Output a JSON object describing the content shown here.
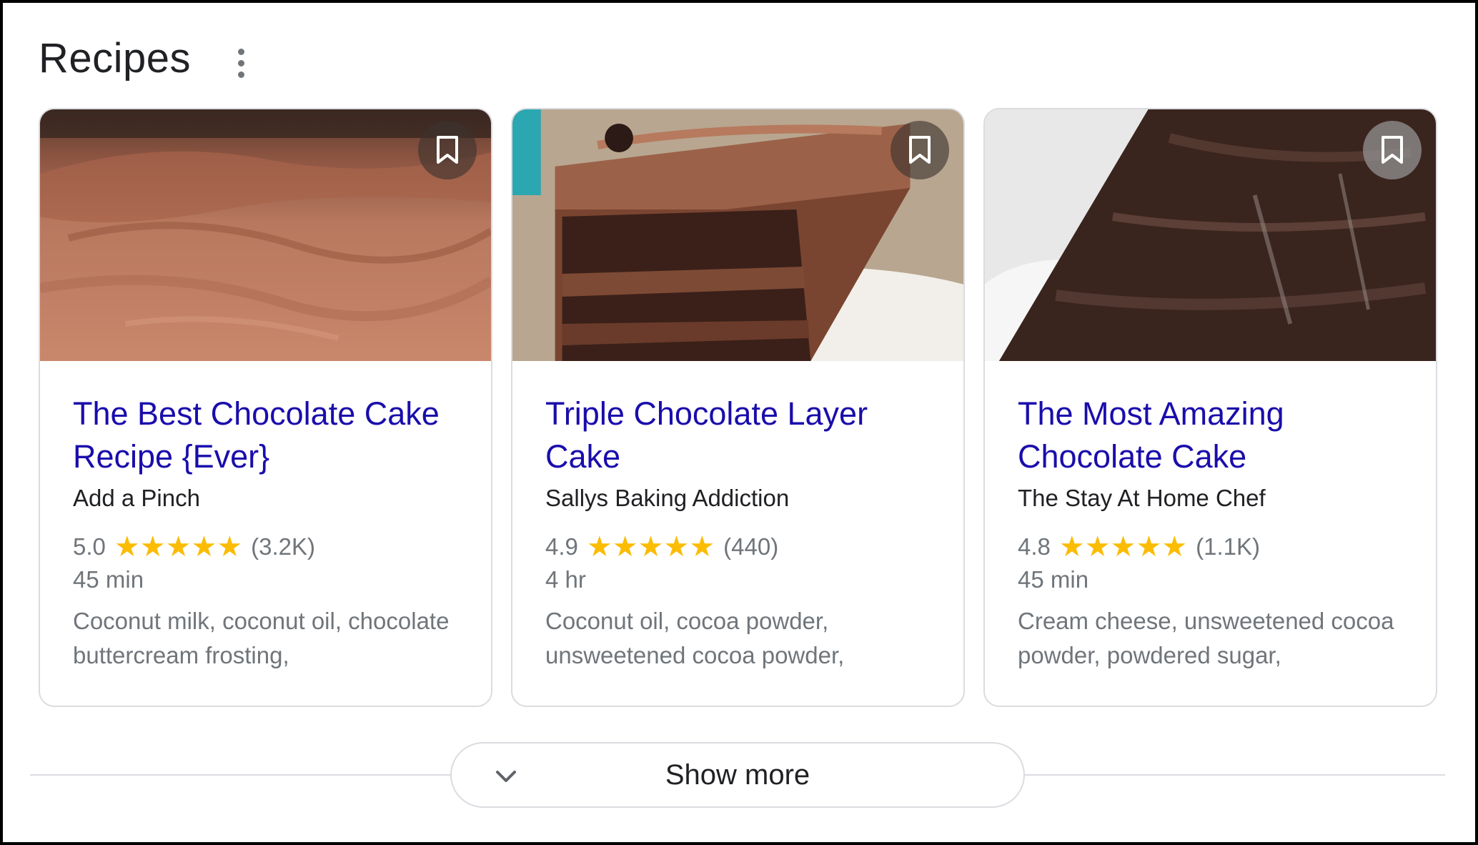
{
  "header": {
    "title": "Recipes",
    "menu_icon": "more-vert-icon"
  },
  "colors": {
    "title_link": "#1a0dab",
    "star": "#fbbc04",
    "muted": "#70757a",
    "text": "#202124",
    "border": "#dadce0"
  },
  "cards": [
    {
      "title": "The Best Chocolate Cake Recipe {Ever}",
      "source": "Add a Pinch",
      "rating": "5.0",
      "stars": 5,
      "reviews": "(3.2K)",
      "time": "45 min",
      "ingredients": "Coconut milk, coconut oil, chocolate buttercream frosting,",
      "bookmark_icon": "bookmark-icon"
    },
    {
      "title": "Triple Chocolate Layer Cake",
      "source": "Sallys Baking Addiction",
      "rating": "4.9",
      "stars": 5,
      "reviews": "(440)",
      "time": "4 hr",
      "ingredients": "Coconut oil, cocoa powder, unsweetened cocoa powder,",
      "bookmark_icon": "bookmark-icon"
    },
    {
      "title": "The Most Amazing Chocolate Cake",
      "source": "The Stay At Home Chef",
      "rating": "4.8",
      "stars": 5,
      "reviews": "(1.1K)",
      "time": "45 min",
      "ingredients": "Cream cheese, unsweetened cocoa powder, powdered sugar,",
      "bookmark_icon": "bookmark-icon"
    }
  ],
  "show_more": {
    "label": "Show more",
    "icon": "chevron-down-icon"
  }
}
